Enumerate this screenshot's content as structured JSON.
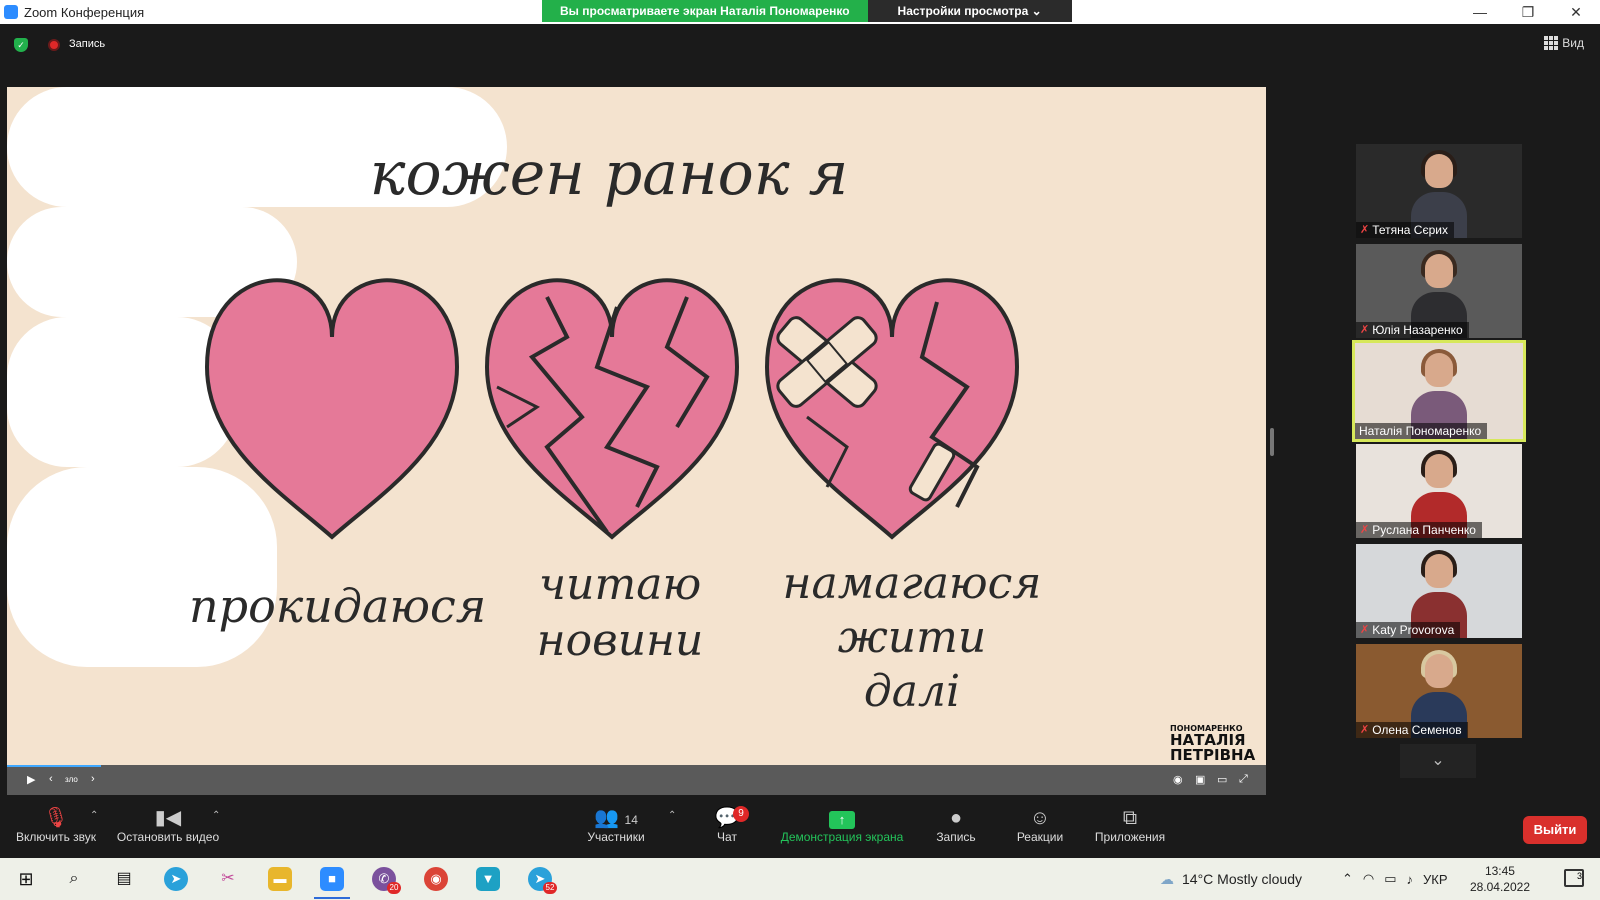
{
  "window": {
    "title": "Zoom Конференция",
    "controls": [
      "—",
      "❐",
      "✕"
    ]
  },
  "share_banner": {
    "viewing": "Вы просматриваете экран Наталія Пономаренко",
    "settings": "Настройки просмотра ⌄"
  },
  "topbar": {
    "recording_label": "Запись",
    "view_label": "Вид"
  },
  "slide": {
    "title": "кожен ранок я",
    "captions": [
      {
        "lines": [
          "прокидаюся"
        ]
      },
      {
        "lines": [
          "читаю",
          "новини"
        ]
      },
      {
        "lines": [
          "намагаюся",
          "жити",
          "далі"
        ]
      }
    ],
    "signature_small": "ПОНОМАРЕНКО",
    "signature_large": "НАТАЛІЯ ПЕТРІВНА",
    "colors": {
      "background": "#f4e3cf",
      "heart_fill": "#e57998",
      "heart_stroke": "#2a2a2a"
    }
  },
  "player": {
    "time_label": "зло",
    "progress": 0.075
  },
  "participants": [
    {
      "name": "Тетяна Сєрих",
      "muted": true
    },
    {
      "name": "Юлія Назаренко",
      "muted": true
    },
    {
      "name": "Наталія Пономаренко",
      "muted": false,
      "active": true
    },
    {
      "name": "Руслана Панченко",
      "muted": true
    },
    {
      "name": "Katy Provorova",
      "muted": true
    },
    {
      "name": "Олена Семенов",
      "muted": true
    }
  ],
  "toolbar": {
    "unmute_label": "Включить звук",
    "stop_video_label": "Остановить видео",
    "participants_label": "Участники",
    "participants_count": "14",
    "chat_label": "Чат",
    "chat_badge": "9",
    "share_label": "Демонстрация экрана",
    "record_label": "Запись",
    "reactions_label": "Реакции",
    "apps_label": "Приложения",
    "leave_label": "Выйти"
  },
  "taskbar": {
    "weather": "14°C  Mostly cloudy",
    "language": "УКР",
    "time": "13:45",
    "date": "28.04.2022",
    "notifications": "3",
    "badges": {
      "viber": "20",
      "telegram2": "52"
    }
  }
}
